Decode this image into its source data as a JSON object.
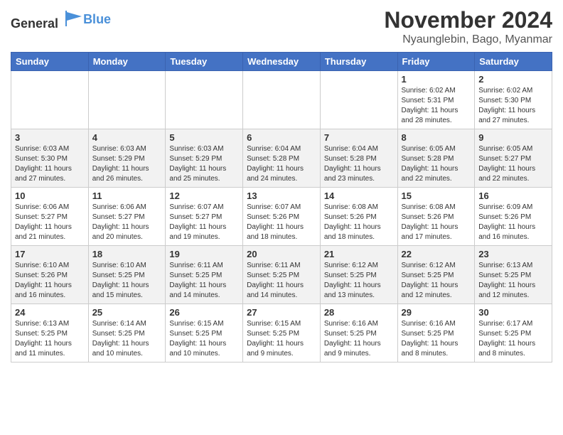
{
  "header": {
    "logo_line1": "General",
    "logo_line2": "Blue",
    "month": "November 2024",
    "location": "Nyaunglebin, Bago, Myanmar"
  },
  "weekdays": [
    "Sunday",
    "Monday",
    "Tuesday",
    "Wednesday",
    "Thursday",
    "Friday",
    "Saturday"
  ],
  "weeks": [
    [
      {
        "day": "",
        "info": ""
      },
      {
        "day": "",
        "info": ""
      },
      {
        "day": "",
        "info": ""
      },
      {
        "day": "",
        "info": ""
      },
      {
        "day": "",
        "info": ""
      },
      {
        "day": "1",
        "info": "Sunrise: 6:02 AM\nSunset: 5:31 PM\nDaylight: 11 hours and 28 minutes."
      },
      {
        "day": "2",
        "info": "Sunrise: 6:02 AM\nSunset: 5:30 PM\nDaylight: 11 hours and 27 minutes."
      }
    ],
    [
      {
        "day": "3",
        "info": "Sunrise: 6:03 AM\nSunset: 5:30 PM\nDaylight: 11 hours and 27 minutes."
      },
      {
        "day": "4",
        "info": "Sunrise: 6:03 AM\nSunset: 5:29 PM\nDaylight: 11 hours and 26 minutes."
      },
      {
        "day": "5",
        "info": "Sunrise: 6:03 AM\nSunset: 5:29 PM\nDaylight: 11 hours and 25 minutes."
      },
      {
        "day": "6",
        "info": "Sunrise: 6:04 AM\nSunset: 5:28 PM\nDaylight: 11 hours and 24 minutes."
      },
      {
        "day": "7",
        "info": "Sunrise: 6:04 AM\nSunset: 5:28 PM\nDaylight: 11 hours and 23 minutes."
      },
      {
        "day": "8",
        "info": "Sunrise: 6:05 AM\nSunset: 5:28 PM\nDaylight: 11 hours and 22 minutes."
      },
      {
        "day": "9",
        "info": "Sunrise: 6:05 AM\nSunset: 5:27 PM\nDaylight: 11 hours and 22 minutes."
      }
    ],
    [
      {
        "day": "10",
        "info": "Sunrise: 6:06 AM\nSunset: 5:27 PM\nDaylight: 11 hours and 21 minutes."
      },
      {
        "day": "11",
        "info": "Sunrise: 6:06 AM\nSunset: 5:27 PM\nDaylight: 11 hours and 20 minutes."
      },
      {
        "day": "12",
        "info": "Sunrise: 6:07 AM\nSunset: 5:27 PM\nDaylight: 11 hours and 19 minutes."
      },
      {
        "day": "13",
        "info": "Sunrise: 6:07 AM\nSunset: 5:26 PM\nDaylight: 11 hours and 18 minutes."
      },
      {
        "day": "14",
        "info": "Sunrise: 6:08 AM\nSunset: 5:26 PM\nDaylight: 11 hours and 18 minutes."
      },
      {
        "day": "15",
        "info": "Sunrise: 6:08 AM\nSunset: 5:26 PM\nDaylight: 11 hours and 17 minutes."
      },
      {
        "day": "16",
        "info": "Sunrise: 6:09 AM\nSunset: 5:26 PM\nDaylight: 11 hours and 16 minutes."
      }
    ],
    [
      {
        "day": "17",
        "info": "Sunrise: 6:10 AM\nSunset: 5:26 PM\nDaylight: 11 hours and 16 minutes."
      },
      {
        "day": "18",
        "info": "Sunrise: 6:10 AM\nSunset: 5:25 PM\nDaylight: 11 hours and 15 minutes."
      },
      {
        "day": "19",
        "info": "Sunrise: 6:11 AM\nSunset: 5:25 PM\nDaylight: 11 hours and 14 minutes."
      },
      {
        "day": "20",
        "info": "Sunrise: 6:11 AM\nSunset: 5:25 PM\nDaylight: 11 hours and 14 minutes."
      },
      {
        "day": "21",
        "info": "Sunrise: 6:12 AM\nSunset: 5:25 PM\nDaylight: 11 hours and 13 minutes."
      },
      {
        "day": "22",
        "info": "Sunrise: 6:12 AM\nSunset: 5:25 PM\nDaylight: 11 hours and 12 minutes."
      },
      {
        "day": "23",
        "info": "Sunrise: 6:13 AM\nSunset: 5:25 PM\nDaylight: 11 hours and 12 minutes."
      }
    ],
    [
      {
        "day": "24",
        "info": "Sunrise: 6:13 AM\nSunset: 5:25 PM\nDaylight: 11 hours and 11 minutes."
      },
      {
        "day": "25",
        "info": "Sunrise: 6:14 AM\nSunset: 5:25 PM\nDaylight: 11 hours and 10 minutes."
      },
      {
        "day": "26",
        "info": "Sunrise: 6:15 AM\nSunset: 5:25 PM\nDaylight: 11 hours and 10 minutes."
      },
      {
        "day": "27",
        "info": "Sunrise: 6:15 AM\nSunset: 5:25 PM\nDaylight: 11 hours and 9 minutes."
      },
      {
        "day": "28",
        "info": "Sunrise: 6:16 AM\nSunset: 5:25 PM\nDaylight: 11 hours and 9 minutes."
      },
      {
        "day": "29",
        "info": "Sunrise: 6:16 AM\nSunset: 5:25 PM\nDaylight: 11 hours and 8 minutes."
      },
      {
        "day": "30",
        "info": "Sunrise: 6:17 AM\nSunset: 5:25 PM\nDaylight: 11 hours and 8 minutes."
      }
    ]
  ]
}
